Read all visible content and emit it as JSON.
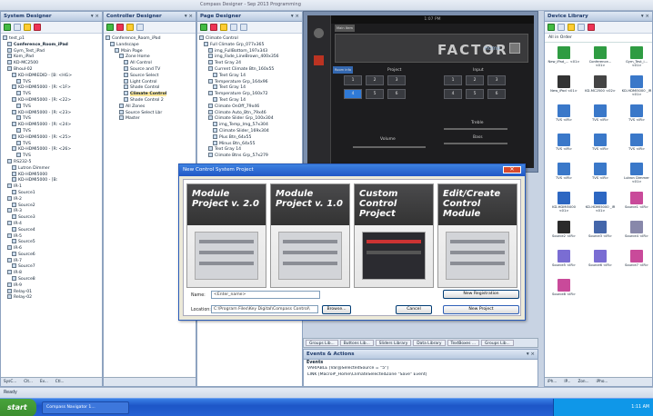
{
  "window": {
    "title": "Compass Designer - Sep 2013 Programming"
  },
  "system_designer": {
    "title": "System Designer",
    "controls": "▾ ×",
    "items": [
      "test_p1",
      "Conference_Room_iPad",
      "Gym_Test_iPad",
      "Kom_iPad",
      "KD-MC2500",
      "Bhoul-02",
      "KD-HDMIEDID - [B: <HG>",
      "TVS",
      "KD-HDMI5000 - [R: <1F>",
      "TVS",
      "KD-HDMI5000 - [R: <22>",
      "TVS",
      "KD-HDMI5000 - [R: <23>",
      "TVS",
      "KD-HDMI5000 - [R: <24>",
      "TVS",
      "KD-HDMI5000 - [R: <25>",
      "TVS",
      "KD-HDMI5000 - [R: <26>",
      "TVS",
      "RS232-5",
      "Lutron Dimmer",
      "KD-HDMI5000",
      "KD-HDMI5000 - [B:",
      "IR-1",
      "Source1",
      "IR-2",
      "Source2",
      "IR-3",
      "Source3",
      "IR-4",
      "Source4",
      "IR-5",
      "Source5",
      "IR-6",
      "Source6",
      "IR-7",
      "Source7",
      "IR-8",
      "Source8",
      "IR-9",
      "Relay-01",
      "Relay-02"
    ],
    "bottom_tabs": [
      "SysC...",
      "Clt...",
      "Ev...",
      "Ctl..."
    ]
  },
  "controller_designer": {
    "title": "Controller Designer",
    "controls": "▾ ×",
    "items": [
      "Conference_Room_iPad",
      "Landscape",
      "Main Page",
      "Zone Home",
      "All Control",
      "Source and TV",
      "Source Select",
      "Light Control",
      "Shade Control",
      "Climate Control",
      "Shade Control 2",
      "All Zones",
      "Source Select Lbr",
      "Master"
    ]
  },
  "page_designer": {
    "title": "Page Designer",
    "controls": "▾ ×",
    "items": [
      "Climate Control",
      "Full Climate Grp_077x365",
      "img_FullBottom_197x343",
      "img_Fade_LineBrown_400x356",
      "Text Gray 24",
      "Current Climate Btn_160x55",
      "Text Gray 14",
      "Temperature Grp_164x96",
      "Text Gray 14",
      "Temperature Grp_160x72",
      "Text Gray 14",
      "Climate OnOff_79x46",
      "Climate Auto_Btn_79x46",
      "Climate Slider Grp_100x304",
      "img_Temp_Img_57x304",
      "Climate Slider_169x304",
      "Plus Btn_64x55",
      "Minus Btn_64x55",
      "Text Gray 14",
      "Climate Btns Grp_57x279"
    ]
  },
  "app_preview": {
    "tabs": [
      "Main Item",
      "Room info"
    ],
    "brand": "FACTOR",
    "home": "Home",
    "top_label": "1:07 PM",
    "col_labels": [
      "Project",
      "Input"
    ],
    "keypad_left": [
      "1",
      "2",
      "3",
      "4",
      "5",
      "6"
    ],
    "keypad_right": [
      "1",
      "2",
      "3",
      "4",
      "5",
      "6"
    ],
    "slider_labels": [
      "Volume",
      "Treble",
      "Bass"
    ]
  },
  "dialog": {
    "title": "New Control System Project",
    "close_glyph": "✕",
    "tiles": [
      {
        "label": "Module Project v. 2.0"
      },
      {
        "label": "Module Project v. 1.0"
      },
      {
        "label": "Custom Control Project"
      },
      {
        "label": "Edit/Create Control Module"
      }
    ],
    "name_label": "Name:",
    "name_value": "<Enter_name>",
    "location_label": "Location:",
    "location_value": "C:\\Program Files\\Key Digital\\Compass Control\\",
    "browse": "Browse...",
    "new_registration": "New Registration",
    "cancel": "Cancel",
    "new_project": "New Project"
  },
  "device_library": {
    "title": "Device Library",
    "controls": "▾ ×",
    "filter": "All in Order",
    "items": [
      {
        "name": "New_iPad_... <01>",
        "color": "#2f9c42"
      },
      {
        "name": "Conference... <01>",
        "color": "#2f9c42"
      },
      {
        "name": "Gym_Test_i... <01>",
        "color": "#2f9c42"
      },
      {
        "name": "New_iPod <01>",
        "color": "#333333"
      },
      {
        "name": "KD-MC2500 <02>",
        "color": "#444444"
      },
      {
        "name": "KD-HDMI5000 _IR <01>",
        "color": "#3a78c9"
      },
      {
        "name": "TVS <IR>",
        "color": "#3a78c9"
      },
      {
        "name": "TVS <IR>",
        "color": "#3a78c9"
      },
      {
        "name": "TVS <IR>",
        "color": "#3a78c9"
      },
      {
        "name": "TVS <IR>",
        "color": "#3a78c9"
      },
      {
        "name": "TVS <IR>",
        "color": "#3a78c9"
      },
      {
        "name": "TVS <IR>",
        "color": "#3a78c9"
      },
      {
        "name": "TVS <IR>",
        "color": "#3a78c9"
      },
      {
        "name": "TVS <IR>",
        "color": "#3a78c9"
      },
      {
        "name": "Lutron Dimmer <01>",
        "color": "#3a78c9"
      },
      {
        "name": "KD-HDMI5000 <01>",
        "color": "#2d67c2"
      },
      {
        "name": "KD-HDMI5000 _IR <01>",
        "color": "#2d67c2"
      },
      {
        "name": "Source1 <IR>",
        "color": "#c94a9a"
      },
      {
        "name": "Source2 <IR>",
        "color": "#2a2a2a"
      },
      {
        "name": "Source3 <IR>",
        "color": "#4466aa"
      },
      {
        "name": "Source4 <IR>",
        "color": "#8888aa"
      },
      {
        "name": "Source5 <IR>",
        "color": "#7a6dd3"
      },
      {
        "name": "Source6 <IR>",
        "color": "#7a6dd3"
      },
      {
        "name": "Source7 <IR>",
        "color": "#c94a9a"
      },
      {
        "name": "Source8 <IR>",
        "color": "#c94a9a"
      }
    ],
    "bottom_tabs": [
      "iPh...",
      "IP...",
      "Zon...",
      "iPho..."
    ]
  },
  "events_actions": {
    "title": "Events & Actions",
    "controls": "▾ ×",
    "tab": "Events",
    "lines": [
      "VARIABLE [Var@SelectedSource = \"5\"]",
      "LINK [Macro#_Home\\ClimateSelectedZone \"Save\" Event]"
    ]
  },
  "lower_tabs": [
    "Groups Lib...",
    "Buttons Lib...",
    "Sliders Library",
    "Data Library",
    "TextBoxes ...",
    "Groups Lib..."
  ],
  "status": {
    "text": "Ready"
  },
  "taskbar": {
    "start": "start",
    "item": "Compass Navigator 1...",
    "clock": "1:11 AM"
  }
}
